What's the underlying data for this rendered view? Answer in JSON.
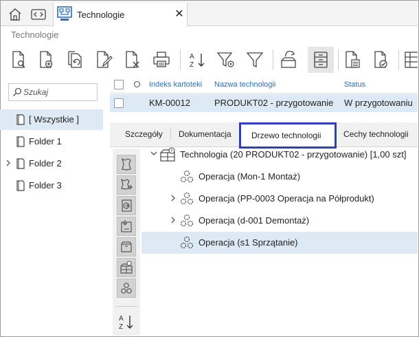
{
  "tabstrip": {
    "home_icon": "home-icon",
    "split_icon": "split-view-icon",
    "tab_title": "Technologie",
    "close_glyph": "✕"
  },
  "breadcrumb": "Technologie",
  "toolbar": {
    "buttons": [
      "document-preview-icon",
      "document-add-icon",
      "document-copy-icon",
      "document-edit-icon",
      "document-delete-icon",
      "print-icon",
      "sort-az-icon",
      "filter-settings-icon",
      "filter-icon",
      "process-icon",
      "list-view-icon",
      "document-list-icon",
      "document-check-icon"
    ]
  },
  "search": {
    "placeholder": "Szukaj"
  },
  "sidebar": {
    "items": [
      {
        "label": "[ Wszystkie ]",
        "selected": true,
        "expandable": false
      },
      {
        "label": "Folder 1",
        "selected": false,
        "expandable": false
      },
      {
        "label": "Folder 2",
        "selected": false,
        "expandable": true
      },
      {
        "label": "Folder 3",
        "selected": false,
        "expandable": false
      }
    ]
  },
  "table": {
    "columns": [
      "Indeks kartoteki",
      "Nazwa technologii",
      "Status"
    ],
    "rows": [
      {
        "index": "KM-00012",
        "name": "PRODUKT02 - przygotowanie",
        "status": "W przygotowaniu"
      }
    ]
  },
  "detail_tabs": {
    "tabs": [
      "Szczegóły",
      "Dokumentacja",
      "Drzewo technologii",
      "Cechy technologii"
    ],
    "active": "Drzewo technologii"
  },
  "side_actions": [
    "material-icon",
    "material-go-icon",
    "import-icon",
    "export-icon",
    "box-icon",
    "technology-icon",
    "operations-icon",
    "sort-az-icon"
  ],
  "tree": {
    "root": {
      "label": "Technologia (20 PRODUKT02 - przygotowanie) [1,00 szt]"
    },
    "children": [
      {
        "label": "Operacja (Mon-1 Montaż)",
        "expandable": false,
        "selected": false
      },
      {
        "label": "Operacja (PP-0003 Operacja na Półprodukt)",
        "expandable": true,
        "selected": false
      },
      {
        "label": "Operacja (d-001 Demontaż)",
        "expandable": true,
        "selected": false
      },
      {
        "label": "Operacja (s1 Sprzątanie)",
        "expandable": false,
        "selected": true
      }
    ]
  },
  "colors": {
    "accent": "#2f6db3",
    "selection": "#dde9f4",
    "active_tab_border": "#2f3fb8"
  }
}
